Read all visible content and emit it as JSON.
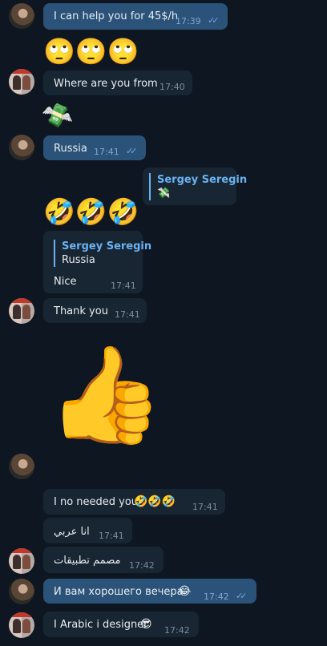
{
  "messages": {
    "m1": {
      "text": "I can help you for 45$/h",
      "time": "17:39",
      "status": "read"
    },
    "m2": {
      "emoji": "🙄🙄🙄"
    },
    "m3": {
      "text": "Where are you from",
      "time": "17:40"
    },
    "m4": {
      "sticker": "💸"
    },
    "m5": {
      "text": "Russia",
      "time": "17:41",
      "status": "read"
    },
    "m6": {
      "quote_name": "Sergey Seregin",
      "quote_text": "💸"
    },
    "m7": {
      "emoji": "🤣🤣🤣"
    },
    "m8": {
      "quote_name": "Sergey Seregin",
      "quote_text": "Russia",
      "text": "Nice",
      "time": "17:41"
    },
    "m9": {
      "text": "Thank you",
      "time": "17:41"
    },
    "m10": {
      "sticker": "👍"
    },
    "m11": {
      "text": "I no needed you",
      "emoji": "🤣🤣🤣",
      "time": "17:41"
    },
    "m12": {
      "text": "انا عربي",
      "time": "17:41"
    },
    "m13": {
      "text": "مصمم تطبيقات",
      "time": "17:42"
    },
    "m14": {
      "text": "И вам хорошего вечера",
      "emoji": "😂",
      "time": "17:42",
      "status": "read"
    },
    "m15": {
      "text": "I Arabic i designer",
      "emoji": "😎",
      "time": "17:42"
    }
  },
  "icons": {
    "read": "double-check-icon"
  },
  "colors": {
    "background": "#0e1621",
    "incoming": "#182533",
    "outgoing": "#2b5278",
    "accent": "#6ab2f2"
  }
}
